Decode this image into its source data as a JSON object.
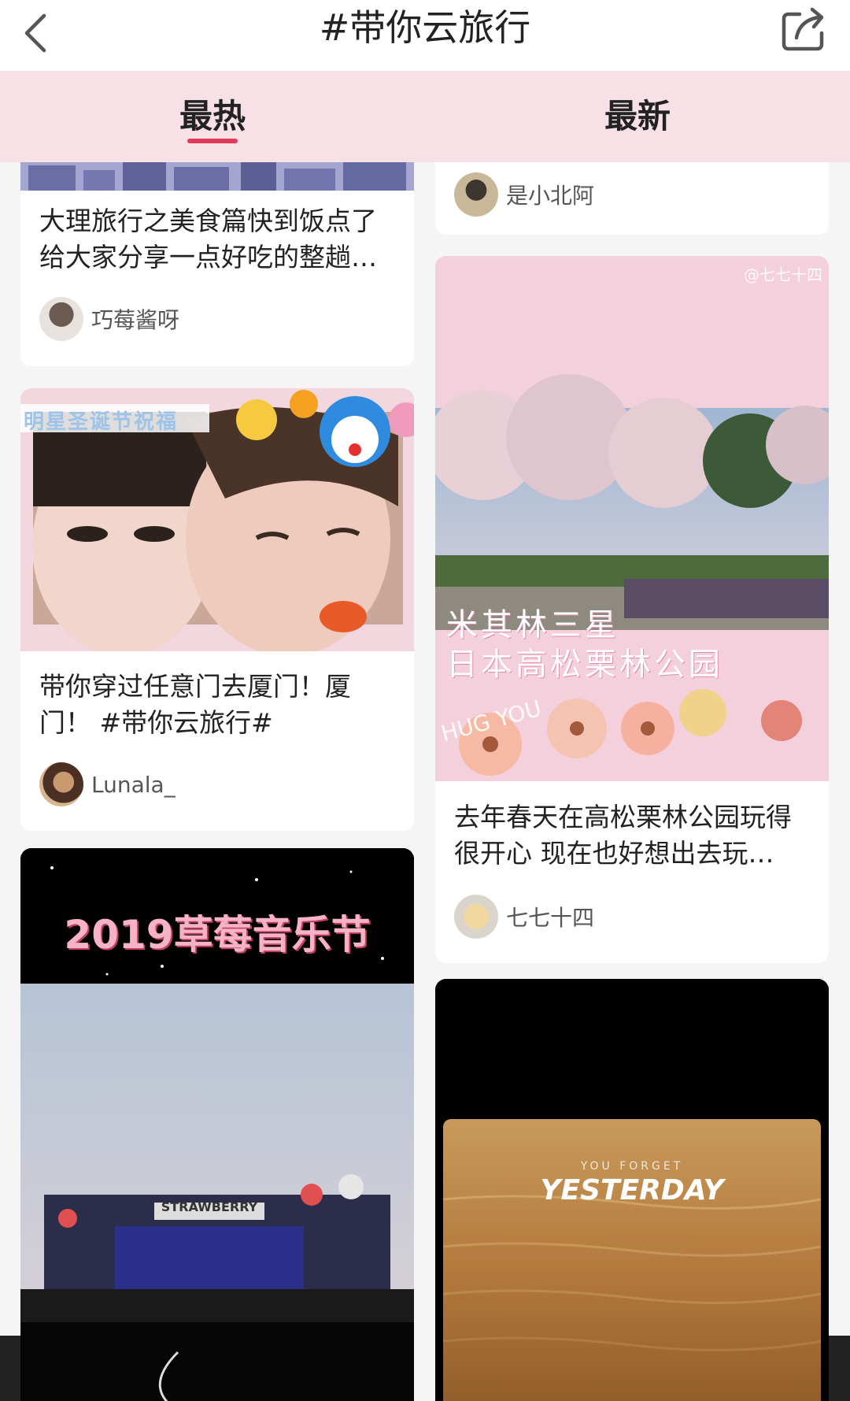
{
  "header": {
    "title": "#带你云旅行",
    "back_icon": "chevron-left-icon",
    "share_icon": "share-icon"
  },
  "tabs": [
    {
      "label": "最热",
      "active": true
    },
    {
      "label": "最新",
      "active": false
    }
  ],
  "accent_color": "#e03a5a",
  "tab_bg_color": "#f7e0e6",
  "left_column": [
    {
      "title": "大理旅行之美食篇快到饭点了给大家分享一点好吃的整趟…",
      "author": "巧莓酱呀"
    },
    {
      "thumb_overlay": "明星圣诞节祝福",
      "title": "带你穿过任意门去厦门！厦门！ #带你云旅行#",
      "author": "Lunala_"
    },
    {
      "thumb_overlay": "2019草莓音乐节",
      "thumb_sign": "STRAWBERRY"
    }
  ],
  "right_column": [
    {
      "author": "是小北阿"
    },
    {
      "thumb_watermark": "@七七十四",
      "thumb_overlay_line1": "米其林三星",
      "thumb_overlay_line2": "日本高松栗林公园",
      "thumb_overlay_small": "HUG YOU",
      "title": "去年春天在高松栗林公园玩得很开心 现在也好想出去玩…",
      "author": "七七十四"
    },
    {
      "thumb_overlay_small": "YOU FORGET",
      "thumb_overlay": "YESTERDAY"
    }
  ]
}
